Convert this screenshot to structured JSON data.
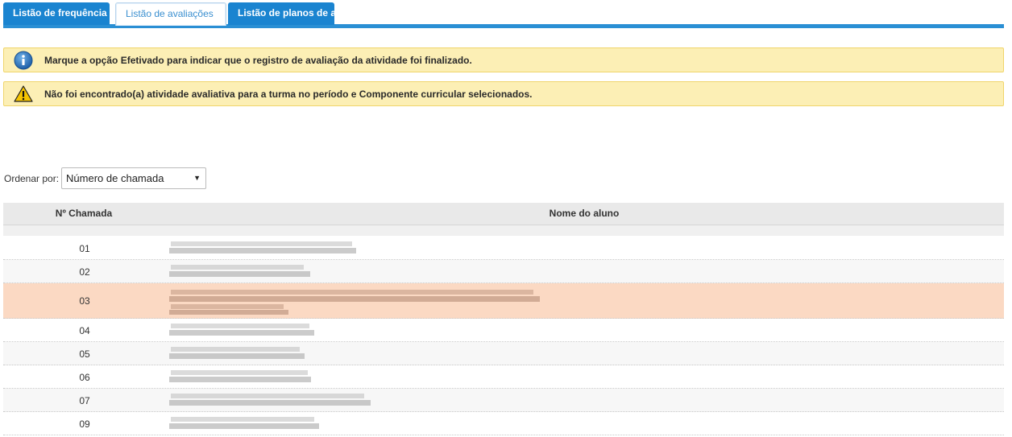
{
  "tabs": [
    {
      "label": "Listão de frequência"
    },
    {
      "label": "Listão de avaliações"
    },
    {
      "label": "Listão de planos de aula"
    }
  ],
  "alerts": {
    "info": "Marque a opção Efetivado para indicar que o registro de avaliação da atividade foi finalizado.",
    "warning": "Não foi encontrado(a) atividade avaliativa para a turma no período e Componente curricular selecionados."
  },
  "order": {
    "label": "Ordenar por:",
    "selected": "Número de chamada"
  },
  "table": {
    "headers": {
      "number": "Nº Chamada",
      "name": "Nome do aluno"
    },
    "rows": [
      {
        "number": "01"
      },
      {
        "number": "02"
      },
      {
        "number": "03"
      },
      {
        "number": "04"
      },
      {
        "number": "05"
      },
      {
        "number": "06"
      },
      {
        "number": "07"
      },
      {
        "number": "09"
      }
    ]
  },
  "colors": {
    "tab_blue": "#1a84d0",
    "alert_bg": "#fcefb5",
    "highlight_row": "#fbd9c3"
  },
  "icons": {
    "info": "info-circle-icon",
    "warning": "warning-triangle-icon",
    "select_arrow": "triangle-down-icon"
  }
}
